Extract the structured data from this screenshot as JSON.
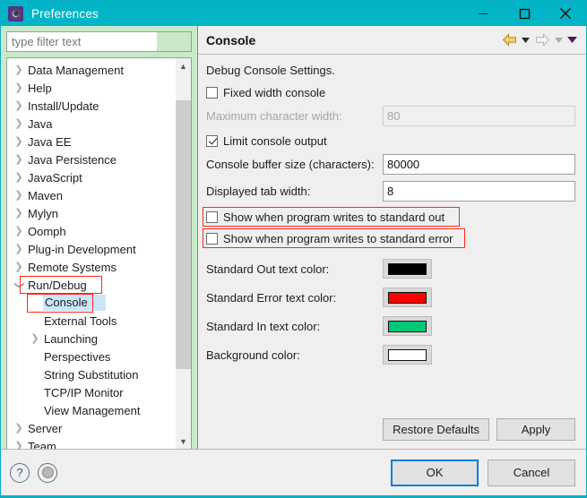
{
  "window": {
    "title": "Preferences",
    "icon": "preferences-gear-icon",
    "titlebar_color": "#02b5c6",
    "controls": {
      "minimize": "minimize-icon",
      "maximize": "maximize-icon",
      "close": "close-icon"
    }
  },
  "sidebar": {
    "filter": {
      "value": "",
      "placeholder": "type filter text"
    },
    "items": [
      {
        "label": "Data Management",
        "level": 1,
        "twisty": "collapsed",
        "selected": false
      },
      {
        "label": "Help",
        "level": 1,
        "twisty": "collapsed",
        "selected": false
      },
      {
        "label": "Install/Update",
        "level": 1,
        "twisty": "collapsed",
        "selected": false
      },
      {
        "label": "Java",
        "level": 1,
        "twisty": "collapsed",
        "selected": false
      },
      {
        "label": "Java EE",
        "level": 1,
        "twisty": "collapsed",
        "selected": false
      },
      {
        "label": "Java Persistence",
        "level": 1,
        "twisty": "collapsed",
        "selected": false
      },
      {
        "label": "JavaScript",
        "level": 1,
        "twisty": "collapsed",
        "selected": false
      },
      {
        "label": "Maven",
        "level": 1,
        "twisty": "collapsed",
        "selected": false
      },
      {
        "label": "Mylyn",
        "level": 1,
        "twisty": "collapsed",
        "selected": false
      },
      {
        "label": "Oomph",
        "level": 1,
        "twisty": "collapsed",
        "selected": false
      },
      {
        "label": "Plug-in Development",
        "level": 1,
        "twisty": "collapsed",
        "selected": false
      },
      {
        "label": "Remote Systems",
        "level": 1,
        "twisty": "collapsed",
        "selected": false
      },
      {
        "label": "Run/Debug",
        "level": 1,
        "twisty": "expanded",
        "selected": false,
        "highlighted": true
      },
      {
        "label": "Console",
        "level": 2,
        "twisty": "none",
        "selected": true,
        "highlighted": true
      },
      {
        "label": "External Tools",
        "level": 2,
        "twisty": "none",
        "selected": false
      },
      {
        "label": "Launching",
        "level": 2,
        "twisty": "collapsed",
        "selected": false
      },
      {
        "label": "Perspectives",
        "level": 2,
        "twisty": "none",
        "selected": false
      },
      {
        "label": "String Substitution",
        "level": 2,
        "twisty": "none",
        "selected": false
      },
      {
        "label": "TCP/IP Monitor",
        "level": 2,
        "twisty": "none",
        "selected": false
      },
      {
        "label": "View Management",
        "level": 2,
        "twisty": "none",
        "selected": false
      },
      {
        "label": "Server",
        "level": 1,
        "twisty": "collapsed",
        "selected": false
      },
      {
        "label": "Team",
        "level": 1,
        "twisty": "collapsed",
        "selected": false
      }
    ],
    "scrollbar": {
      "up": "scroll-up-icon",
      "down": "scroll-down-icon"
    }
  },
  "page": {
    "title": "Console",
    "nav": {
      "back": "back-arrow-icon",
      "back_menu": "caret-down-icon",
      "forward": "forward-arrow-icon",
      "forward_menu": "caret-down-icon",
      "view_menu": "view-menu-caret-icon"
    },
    "intro": "Debug Console Settings.",
    "fixed_width": {
      "label": "Fixed width console",
      "checked": false
    },
    "max_char_width": {
      "label": "Maximum character width:",
      "value": "80",
      "enabled": false
    },
    "limit_output": {
      "label": "Limit console output",
      "checked": true
    },
    "buffer_size": {
      "label": "Console buffer size (characters):",
      "value": "80000"
    },
    "tab_width": {
      "label": "Displayed tab width:",
      "value": "8"
    },
    "show_stdout": {
      "label": "Show when program writes to standard out",
      "checked": false,
      "highlighted": true
    },
    "show_stderr": {
      "label": "Show when program writes to standard error",
      "checked": false,
      "highlighted": true
    },
    "colors": [
      {
        "label": "Standard Out text color:",
        "value": "#000000"
      },
      {
        "label": "Standard Error text color:",
        "value": "#ff0000"
      },
      {
        "label": "Standard In text color:",
        "value": "#00c878"
      },
      {
        "label": "Background color:",
        "value": "#ffffff"
      }
    ],
    "restore_defaults": "Restore Defaults",
    "apply": "Apply"
  },
  "footer": {
    "help": "help-icon",
    "extra": "apply-and-close-icon",
    "ok": "OK",
    "cancel": "Cancel"
  },
  "accents": {
    "annotation": "#ff2a17",
    "selection": "#cde6f7",
    "default_button_border": "#0a7fd6"
  }
}
